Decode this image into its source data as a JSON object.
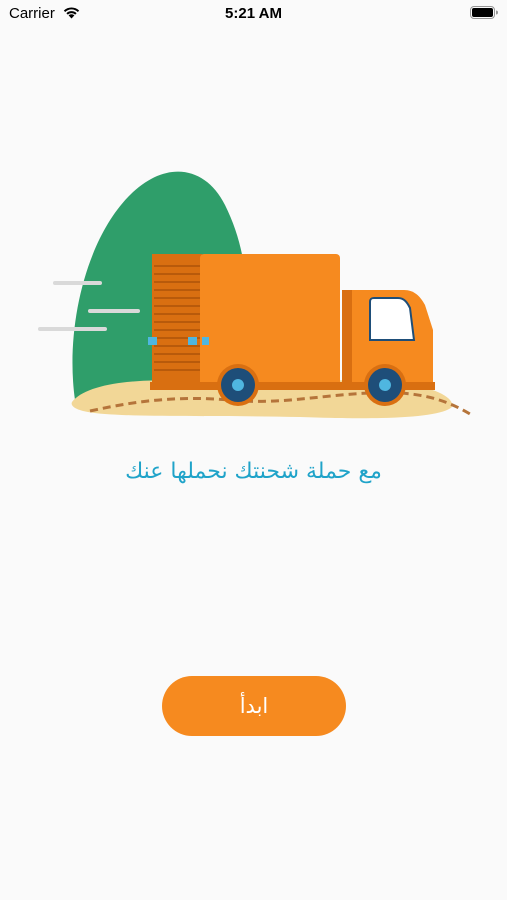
{
  "status_bar": {
    "carrier": "Carrier",
    "time": "5:21 AM"
  },
  "illustration": {
    "icon": "delivery-truck-icon",
    "colors": {
      "truck": "#f68a1f",
      "truck_dark": "#d96f11",
      "bush": "#2f9e6a",
      "ground": "#f2d797",
      "wheel": "#1e4e79",
      "wheel_hub": "#4fb6e0"
    }
  },
  "main": {
    "tagline": "مع حملة شحنتك نحملها عنك",
    "start_button_label": "ابدأ"
  },
  "colors": {
    "accent": "#f68a1f",
    "tagline": "#1fa3c9",
    "background": "#fafafa"
  }
}
